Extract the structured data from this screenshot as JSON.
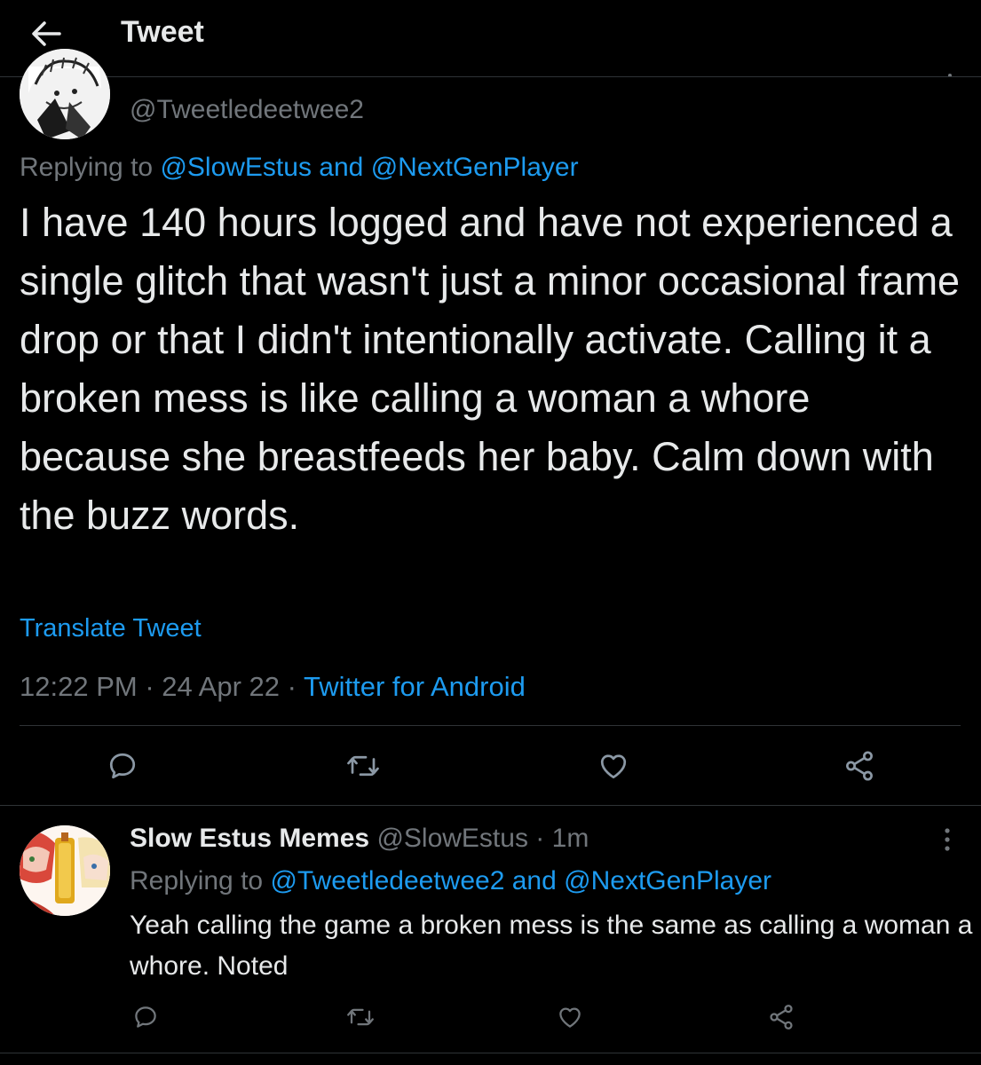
{
  "header": {
    "title": "Tweet"
  },
  "tweet": {
    "handle": "@Tweetledeetwee2",
    "replying_prefix": "Replying to",
    "replying_to_1": "@SlowEstus",
    "replying_and": "and",
    "replying_to_2": "@NextGenPlayer",
    "text": "I have 140 hours logged and have not experienced a single glitch that wasn't just a minor occasional frame drop or that I didn't intentionally activate. Calling it a broken mess is like calling a woman a whore because she breastfeeds her baby. Calm down with the buzz words.",
    "translate_label": "Translate Tweet",
    "time": "12:22 PM",
    "sep1": "·",
    "date": "24 Apr 22",
    "sep2": "·",
    "source": "Twitter for Android"
  },
  "reply": {
    "name": "Slow Estus Memes",
    "handle": "@SlowEstus",
    "sep": "·",
    "time": "1m",
    "replying_prefix": "Replying to",
    "replying_to_1": "@Tweetledeetwee2",
    "replying_and": "and",
    "replying_to_2": "@NextGenPlayer",
    "text": "Yeah calling the game a broken mess is the same as calling a woman a whore. Noted"
  },
  "icons": {
    "back": "back-arrow-icon",
    "reply": "reply-bubble-icon",
    "retweet": "retweet-icon",
    "like": "heart-icon",
    "share": "share-icon",
    "more": "more-vertical-icon"
  },
  "colors": {
    "background": "#000000",
    "text_primary": "#e7e9ea",
    "text_secondary": "#71767b",
    "accent": "#1d9bf0",
    "divider": "#2f3336"
  }
}
